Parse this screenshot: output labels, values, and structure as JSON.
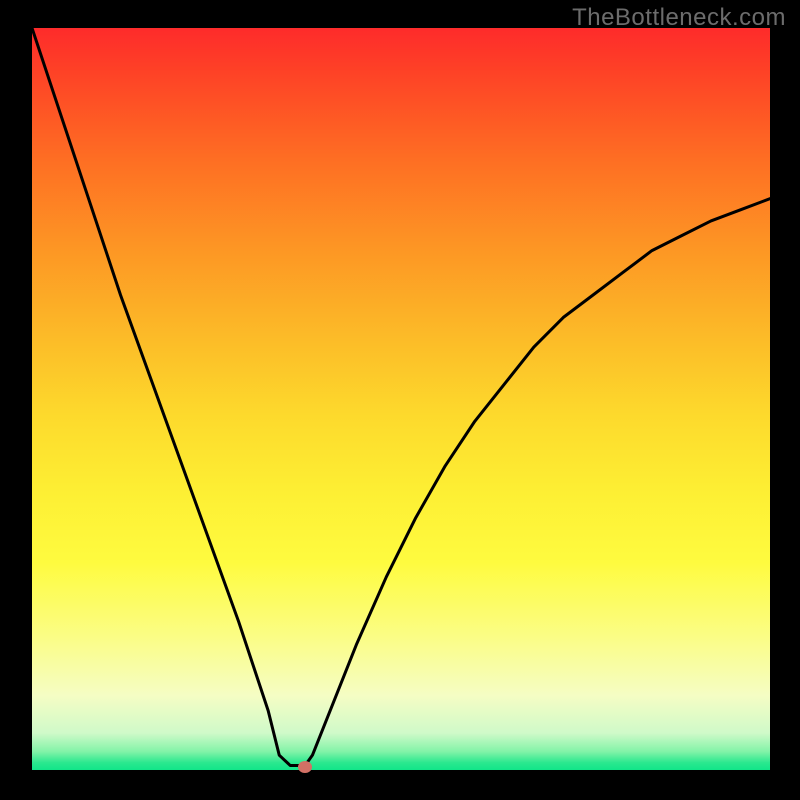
{
  "watermark": "TheBottleneck.com",
  "chart_data": {
    "type": "line",
    "title": "",
    "xlabel": "",
    "ylabel": "",
    "xlim": [
      0,
      100
    ],
    "ylim": [
      0,
      100
    ],
    "series": [
      {
        "name": "bottleneck-curve",
        "x": [
          0,
          4,
          8,
          12,
          16,
          20,
          24,
          28,
          30,
          32,
          33.5,
          35,
          36,
          37,
          38,
          40,
          44,
          48,
          52,
          56,
          60,
          64,
          68,
          72,
          76,
          80,
          84,
          88,
          92,
          96,
          100
        ],
        "values": [
          100,
          88,
          76,
          64,
          53,
          42,
          31,
          20,
          14,
          8,
          2,
          0.6,
          0.6,
          0.6,
          2,
          7,
          17,
          26,
          34,
          41,
          47,
          52,
          57,
          61,
          64,
          67,
          70,
          72,
          74,
          75.5,
          77
        ]
      }
    ],
    "marker": {
      "x": 37,
      "y": 0.4
    },
    "gradient_stops": [
      {
        "pct": 0,
        "color": "#fe2b2b"
      },
      {
        "pct": 50,
        "color": "#fdd92c"
      },
      {
        "pct": 95,
        "color": "#d0fac9"
      },
      {
        "pct": 100,
        "color": "#11e589"
      }
    ]
  }
}
